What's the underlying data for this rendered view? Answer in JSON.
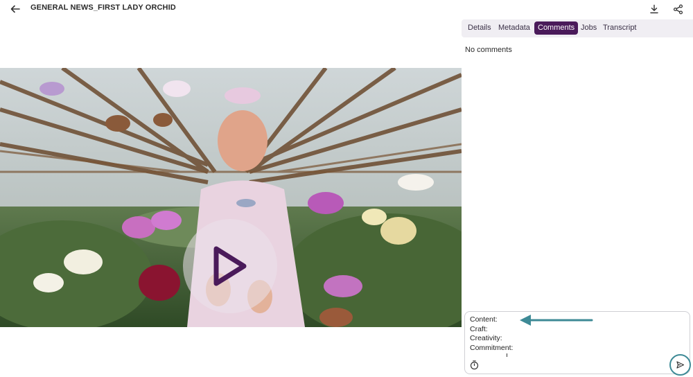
{
  "header": {
    "title": "GENERAL NEWS_FIRST LADY ORCHID",
    "back_icon": "arrow-left-icon",
    "download_icon": "download-icon",
    "share_icon": "share-icon"
  },
  "video": {
    "play_icon": "play-icon",
    "play_color": "#4a1a5a"
  },
  "tabs": [
    {
      "label": "Details",
      "active": false
    },
    {
      "label": "Metadata",
      "active": false
    },
    {
      "label": "Comments",
      "active": true
    },
    {
      "label": "Jobs",
      "active": false
    },
    {
      "label": "Transcript",
      "active": false
    }
  ],
  "comments": {
    "empty_text": "No comments"
  },
  "comment_input": {
    "lines": [
      "Content:",
      "Craft:",
      "Creativity:",
      "Commitment:"
    ],
    "timer_icon": "stopwatch-icon",
    "send_icon": "send-icon"
  },
  "colors": {
    "accent": "#4a1a5a",
    "tab_bg": "#f0eef3",
    "annotation": "#3e8a96"
  }
}
